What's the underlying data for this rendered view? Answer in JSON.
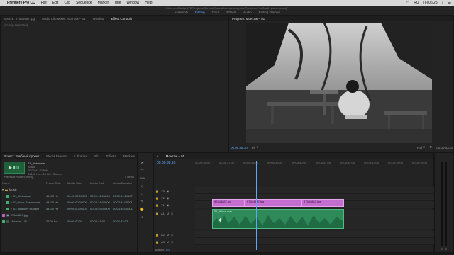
{
  "menubar": {
    "app_name": "Premiere Pro CC",
    "items": [
      "File",
      "Edit",
      "Clip",
      "Sequence",
      "Marker",
      "Title",
      "Window",
      "Help"
    ],
    "flag": "RU",
    "time": "Пн 06:25"
  },
  "window": {
    "title": "/Volumes/Media 4TB/Projects/Cursos/Cursos/Intenciones para Premiere/Учебный проект.prproj *"
  },
  "workspaces": [
    "Assembly",
    "Editing",
    "Color",
    "Effects",
    "Audio",
    "Editing Trained"
  ],
  "source_panel": {
    "tabs": [
      "Source: 97544887.jpg",
      "Audio Clip Mixer: Монтаж – 01",
      "Window",
      "Effect Controls"
    ],
    "no_clip": "(no clip selected)"
  },
  "program": {
    "title": "Program: Монтаж – 01",
    "timecode": "00:00:38:10",
    "zoom": "Fit",
    "quality": "Full",
    "duration": "00:00:43:03",
    "controls": [
      "marker-icon",
      "step-back-icon",
      "play-icon",
      "step-forward-icon",
      "export-frame-icon"
    ]
  },
  "project": {
    "tabs": [
      "Project: Учебный проект",
      "Media Browser",
      "Libraries",
      "Info",
      "Effects",
      "Markers"
    ],
    "meta": [
      "01_Africa.wav",
      "Audio",
      "00:00:41:21806",
      "44100 Hz – 16 bit – Stereo",
      "Used 1 time"
    ],
    "path": "Учебный проект.prproj",
    "count": "4 items",
    "columns": [
      "Name",
      "Frame Rate",
      "Media Start",
      "Media End",
      "Media Duration"
    ],
    "rows": [
      {
        "name": "Music",
        "folder": true,
        "color": "#d0a040",
        "fr": "",
        "ms": "",
        "me": "",
        "md": ""
      },
      {
        "name": "01_Africa.wav",
        "folder": false,
        "color": "#3fae6a",
        "fr": "44100 Hz",
        "ms": "00:00:00:00000",
        "me": "00:00:41:21806",
        "md": "00:00:41:21807"
      },
      {
        "name": "02_Ночь Вселенная",
        "folder": false,
        "color": "#3fae6a",
        "fr": "44100 Hz",
        "ms": "00:00:00:00000",
        "me": "00:02:34:00000",
        "md": "00:02:34:00001"
      },
      {
        "name": "03_Anthony Braxton",
        "folder": false,
        "color": "#3fae6a",
        "fr": "44100 Hz",
        "ms": "00:00:00:00000",
        "me": "00:03:45:00000",
        "md": "00:03:45:00001"
      },
      {
        "name": "97544887.jpg",
        "folder": false,
        "color": "#b060c0",
        "fr": "",
        "ms": "",
        "me": "",
        "md": ""
      },
      {
        "name": "Монтаж – 01",
        "folder": false,
        "color": "#3fae6a",
        "fr": "25,00 fps",
        "ms": "00:00:00:00",
        "me": "00:00:43:02",
        "md": "00:00:43:03"
      }
    ]
  },
  "timeline": {
    "tab": "Монтаж – 01",
    "timecode": "00:00:38:10",
    "ruler": [
      "00:00:36:00",
      "00:00:37:00",
      "00:00:38:00",
      "00:00:39:00",
      "00:00:40:00",
      "00:00:41:00",
      "00:00:42:00",
      "00:00:43:00",
      "00:00:44:00",
      "00:00:45:00"
    ],
    "tracks": [
      "V3",
      "V2",
      "V1",
      "A1",
      "A2",
      "A3",
      "Master"
    ],
    "master_value": "0.0",
    "video_clips": [
      "97544887.jpg",
      "97544887.jpg",
      "97544887.jpg"
    ],
    "audio_clip": "01_Africa.wav"
  },
  "colors": {
    "accent": "#5aa8ff",
    "video_clip": "#c46fd0",
    "audio_clip": "#2f8a5a"
  }
}
